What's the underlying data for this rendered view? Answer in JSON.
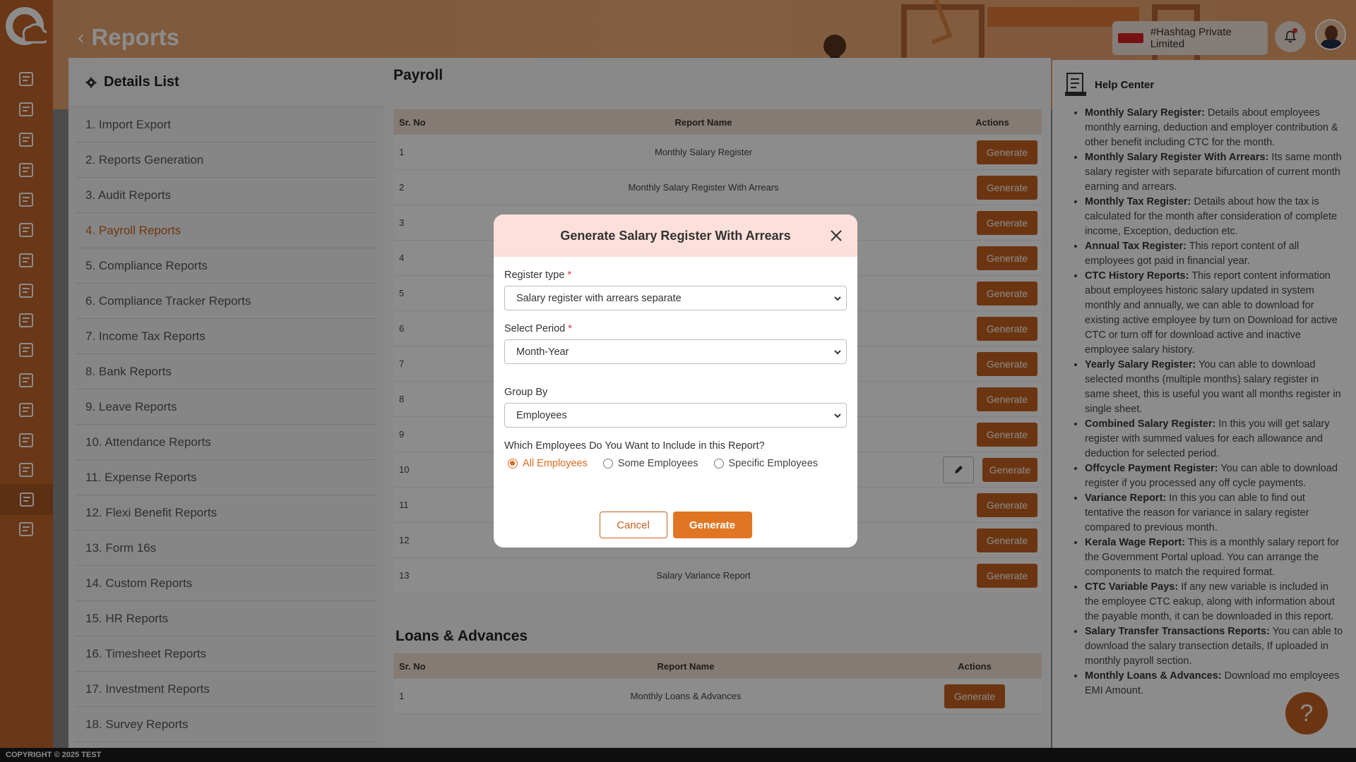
{
  "page": {
    "title": "Reports",
    "company": "#Hashtag Private Limited",
    "footer": "COPYRIGHT © 2025 TEST"
  },
  "colors": {
    "accent": "#c5611f",
    "sidebar": "#c2642a",
    "banner": "#ecac77",
    "modal_head": "#fde0da"
  },
  "sidebar": {
    "icons": [
      "dashboard-icon",
      "analytics-icon",
      "alert-icon",
      "building-icon",
      "document-icon",
      "org-chart-icon",
      "hierarchy-icon",
      "calendar-check-icon",
      "payroll-icon",
      "attendance-icon",
      "policy-icon",
      "list-icon",
      "hand-money-icon",
      "payment-icon",
      "reports-icon",
      "settings-icon"
    ]
  },
  "details_list": {
    "title": "Details List",
    "items": [
      "1. Import Export",
      "2. Reports Generation",
      "3. Audit Reports",
      "4. Payroll Reports",
      "5. Compliance Reports",
      "6. Compliance Tracker Reports",
      "7. Income Tax Reports",
      "8. Bank Reports",
      "9. Leave Reports",
      "10. Attendance Reports",
      "11. Expense Reports",
      "12. Flexi Benefit Reports",
      "13. Form 16s",
      "14. Custom Reports",
      "15. HR Reports",
      "16. Timesheet Reports",
      "17. Investment Reports",
      "18. Survey Reports"
    ],
    "active_index": 3
  },
  "payroll": {
    "title": "Payroll",
    "headers": {
      "sr": "Sr. No",
      "name": "Report Name",
      "actions": "Actions"
    },
    "generate_label": "Generate",
    "rows": [
      {
        "sr": "1",
        "name": "Monthly Salary Register"
      },
      {
        "sr": "2",
        "name": "Monthly Salary Register With Arrears"
      },
      {
        "sr": "3",
        "name": ""
      },
      {
        "sr": "4",
        "name": ""
      },
      {
        "sr": "5",
        "name": ""
      },
      {
        "sr": "6",
        "name": ""
      },
      {
        "sr": "7",
        "name": ""
      },
      {
        "sr": "8",
        "name": ""
      },
      {
        "sr": "9",
        "name": ""
      },
      {
        "sr": "10",
        "name": ""
      },
      {
        "sr": "11",
        "name": ""
      },
      {
        "sr": "12",
        "name": ""
      },
      {
        "sr": "13",
        "name": "Salary Variance Report"
      }
    ]
  },
  "loans": {
    "title": "Loans & Advances",
    "headers": {
      "sr": "Sr. No",
      "name": "Report Name",
      "actions": "Actions"
    },
    "rows": [
      {
        "sr": "1",
        "name": "Monthly Loans & Advances"
      }
    ],
    "generate_label": "Generate"
  },
  "help": {
    "title": "Help Center",
    "items": [
      {
        "term": "Monthly Salary Register:",
        "text": " Details about employees monthly earning, deduction and employer contribution & other benefit including CTC for the month."
      },
      {
        "term": "Monthly Salary Register With Arrears:",
        "text": " Its same month salary register with separate bifurcation of current month earning and arrears."
      },
      {
        "term": "Monthly Tax Register:",
        "text": " Details about how the tax is calculated for the month after consideration of complete income, Exception, deduction etc."
      },
      {
        "term": "Annual Tax Register:",
        "text": " This report content of all employees got paid in financial year."
      },
      {
        "term": "CTC History Reports:",
        "text": " This report content information about employees historic salary updated in system monthly and annually, we can able to download for existing active employee by turn on Download for active CTC or turn off for download active and inactive employee salary history."
      },
      {
        "term": "Yearly Salary Register:",
        "text": " You can able to download selected months (multiple months) salary register in same sheet, this is useful you want all months register in single sheet."
      },
      {
        "term": "Combined Salary Register:",
        "text": " In this you will get salary register with summed values for each allowance and deduction for selected period."
      },
      {
        "term": "Offcycle Payment Register:",
        "text": " You can able to download register if you processed any off cycle payments."
      },
      {
        "term": "Variance Report:",
        "text": " In this you can able to find out tentative the reason for variance in salary register compared to previous month."
      },
      {
        "term": "Kerala Wage Report:",
        "text": " This is a monthly salary report for the Government Portal upload. You can arrange the components to match the required format."
      },
      {
        "term": "CTC Variable Pays:",
        "text": " If any new variable is included in the employee CTC eakup, along with information about the payable month, it can be downloaded in this report."
      },
      {
        "term": "Salary Transfer Transactions Reports:",
        "text": " You can able to download the salary transection details, If uploaded in monthly payroll section."
      },
      {
        "term": "Monthly Loans & Advances:",
        "text": " Download mo employees EMI Amount."
      }
    ]
  },
  "modal": {
    "title": "Generate Salary Register With Arrears",
    "register_type_label": "Register type",
    "register_type_value": "Salary register with arrears separate",
    "period_label": "Select Period",
    "period_value": "Month-Year",
    "group_label": "Group By",
    "group_value": "Employees",
    "include_question": "Which Employees Do You Want to Include in this Report?",
    "options": [
      "All Employees",
      "Some Employees",
      "Specific Employees"
    ],
    "selected_option": "All Employees",
    "required_mark": "*",
    "cancel": "Cancel",
    "generate": "Generate"
  }
}
